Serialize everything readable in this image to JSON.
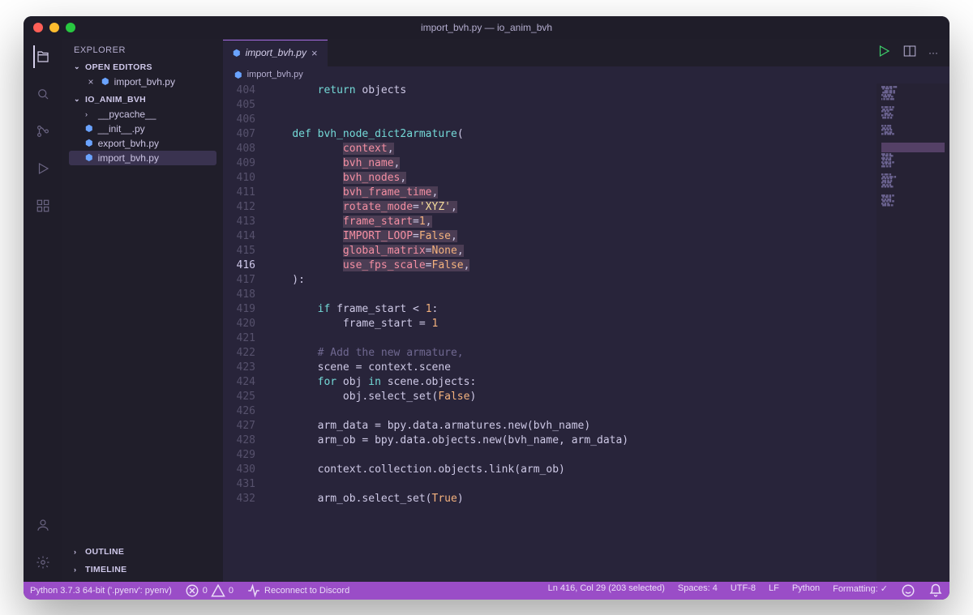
{
  "window_title": "import_bvh.py — io_anim_bvh",
  "explorer_label": "EXPLORER",
  "open_editors_label": "OPEN EDITORS",
  "workspace_name": "IO_ANIM_BVH",
  "open_editor_file": "import_bvh.py",
  "files": {
    "pycache": "__pycache__",
    "init": "__init__.py",
    "export": "export_bvh.py",
    "import": "import_bvh.py"
  },
  "outline_label": "OUTLINE",
  "timeline_label": "TIMELINE",
  "tab": {
    "name": "import_bvh.py"
  },
  "breadcrumb": "import_bvh.py",
  "code": {
    "l404_return": "return",
    "l404_objects": "objects",
    "l407_def": "def",
    "l407_name": "bvh_node_dict2armature",
    "l408": "context",
    "l409": "bvh_name",
    "l410": "bvh_nodes",
    "l411": "bvh_frame_time",
    "l412_k": "rotate_mode",
    "l412_v": "'XYZ'",
    "l413_k": "frame_start",
    "l413_v": "1",
    "l414_k": "IMPORT_LOOP",
    "l414_v": "False",
    "l415_k": "global_matrix",
    "l415_v": "None",
    "l416_k": "use_fps_scale",
    "l416_v": "False",
    "l419_if": "if",
    "l419_expr": "frame_start < ",
    "l419_one": "1",
    "l420_a": "frame_start = ",
    "l420_b": "1",
    "l422": "# Add the new armature,",
    "l423": "scene = context.scene",
    "l424_for": "for",
    "l424_mid": " obj ",
    "l424_in": "in",
    "l424_rest": " scene.objects:",
    "l425_a": "obj.select_set(",
    "l425_b": "False",
    "l425_c": ")",
    "l427": "arm_data = bpy.data.armatures.new(bvh_name)",
    "l428": "arm_ob = bpy.data.objects.new(bvh_name, arm_data)",
    "l430": "context.collection.objects.link(arm_ob)",
    "l432_a": "arm_ob.select_set(",
    "l432_b": "True",
    "l432_c": ")"
  },
  "lines": [
    "404",
    "405",
    "406",
    "407",
    "408",
    "409",
    "410",
    "411",
    "412",
    "413",
    "414",
    "415",
    "416",
    "417",
    "418",
    "419",
    "420",
    "421",
    "422",
    "423",
    "424",
    "425",
    "426",
    "427",
    "428",
    "429",
    "430",
    "431",
    "432"
  ],
  "status": {
    "python": "Python 3.7.3 64-bit ('.pyenv': pyenv)",
    "errors": "0",
    "warnings": "0",
    "discord": "Reconnect to Discord",
    "cursor": "Ln 416, Col 29 (203 selected)",
    "spaces": "Spaces: 4",
    "encoding": "UTF-8",
    "eol": "LF",
    "lang": "Python",
    "formatting": "Formatting: ✓"
  }
}
